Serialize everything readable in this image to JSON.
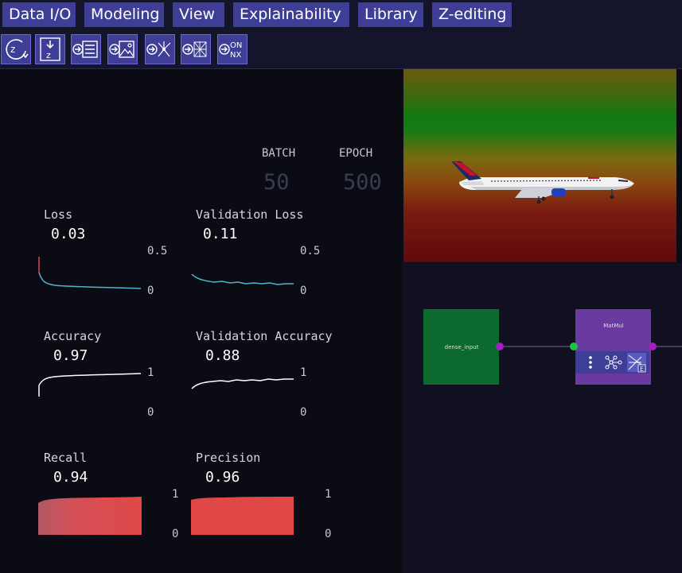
{
  "menu": {
    "items": [
      "Data I/O",
      "Modeling",
      "View",
      "Explainability",
      "Library",
      "Z-editing"
    ]
  },
  "toolbar": {
    "buttons": [
      "z-rotate-icon",
      "z-download-icon",
      "list-import-icon",
      "image-import-icon",
      "graph-import-icon",
      "network-import-icon",
      "onnx-import-icon"
    ],
    "onnx_label_top": "ON",
    "onnx_label_bottom": "NX"
  },
  "training": {
    "batch_label": "BATCH",
    "batch_value": "50",
    "epoch_label": "EPOCH",
    "epoch_value": "500"
  },
  "metrics": {
    "loss": {
      "title": "Loss",
      "value": "0.03",
      "axis_max": "0.5",
      "axis_min": "0"
    },
    "val_loss": {
      "title": "Validation Loss",
      "value": "0.11",
      "axis_max": "0.5",
      "axis_min": "0"
    },
    "accuracy": {
      "title": "Accuracy",
      "value": "0.97",
      "axis_max": "1",
      "axis_min": "0"
    },
    "val_accuracy": {
      "title": "Validation Accuracy",
      "value": "0.88",
      "axis_max": "1",
      "axis_min": "0"
    },
    "recall": {
      "title": "Recall",
      "value": "0.94",
      "axis_max": "1",
      "axis_min": "0"
    },
    "precision": {
      "title": "Precision",
      "value": "0.96",
      "axis_max": "1",
      "axis_min": "0"
    }
  },
  "graph": {
    "nodes": [
      {
        "label": "dense_input",
        "color": "#0d6a2e"
      },
      {
        "label": "MatMul",
        "color": "#6a3aa0"
      }
    ]
  },
  "colors": {
    "menu_button": "#3e3e96",
    "loss_line": "#4fb4c8",
    "accuracy_line": "#ffffff",
    "recall_fill": "#e04848"
  }
}
